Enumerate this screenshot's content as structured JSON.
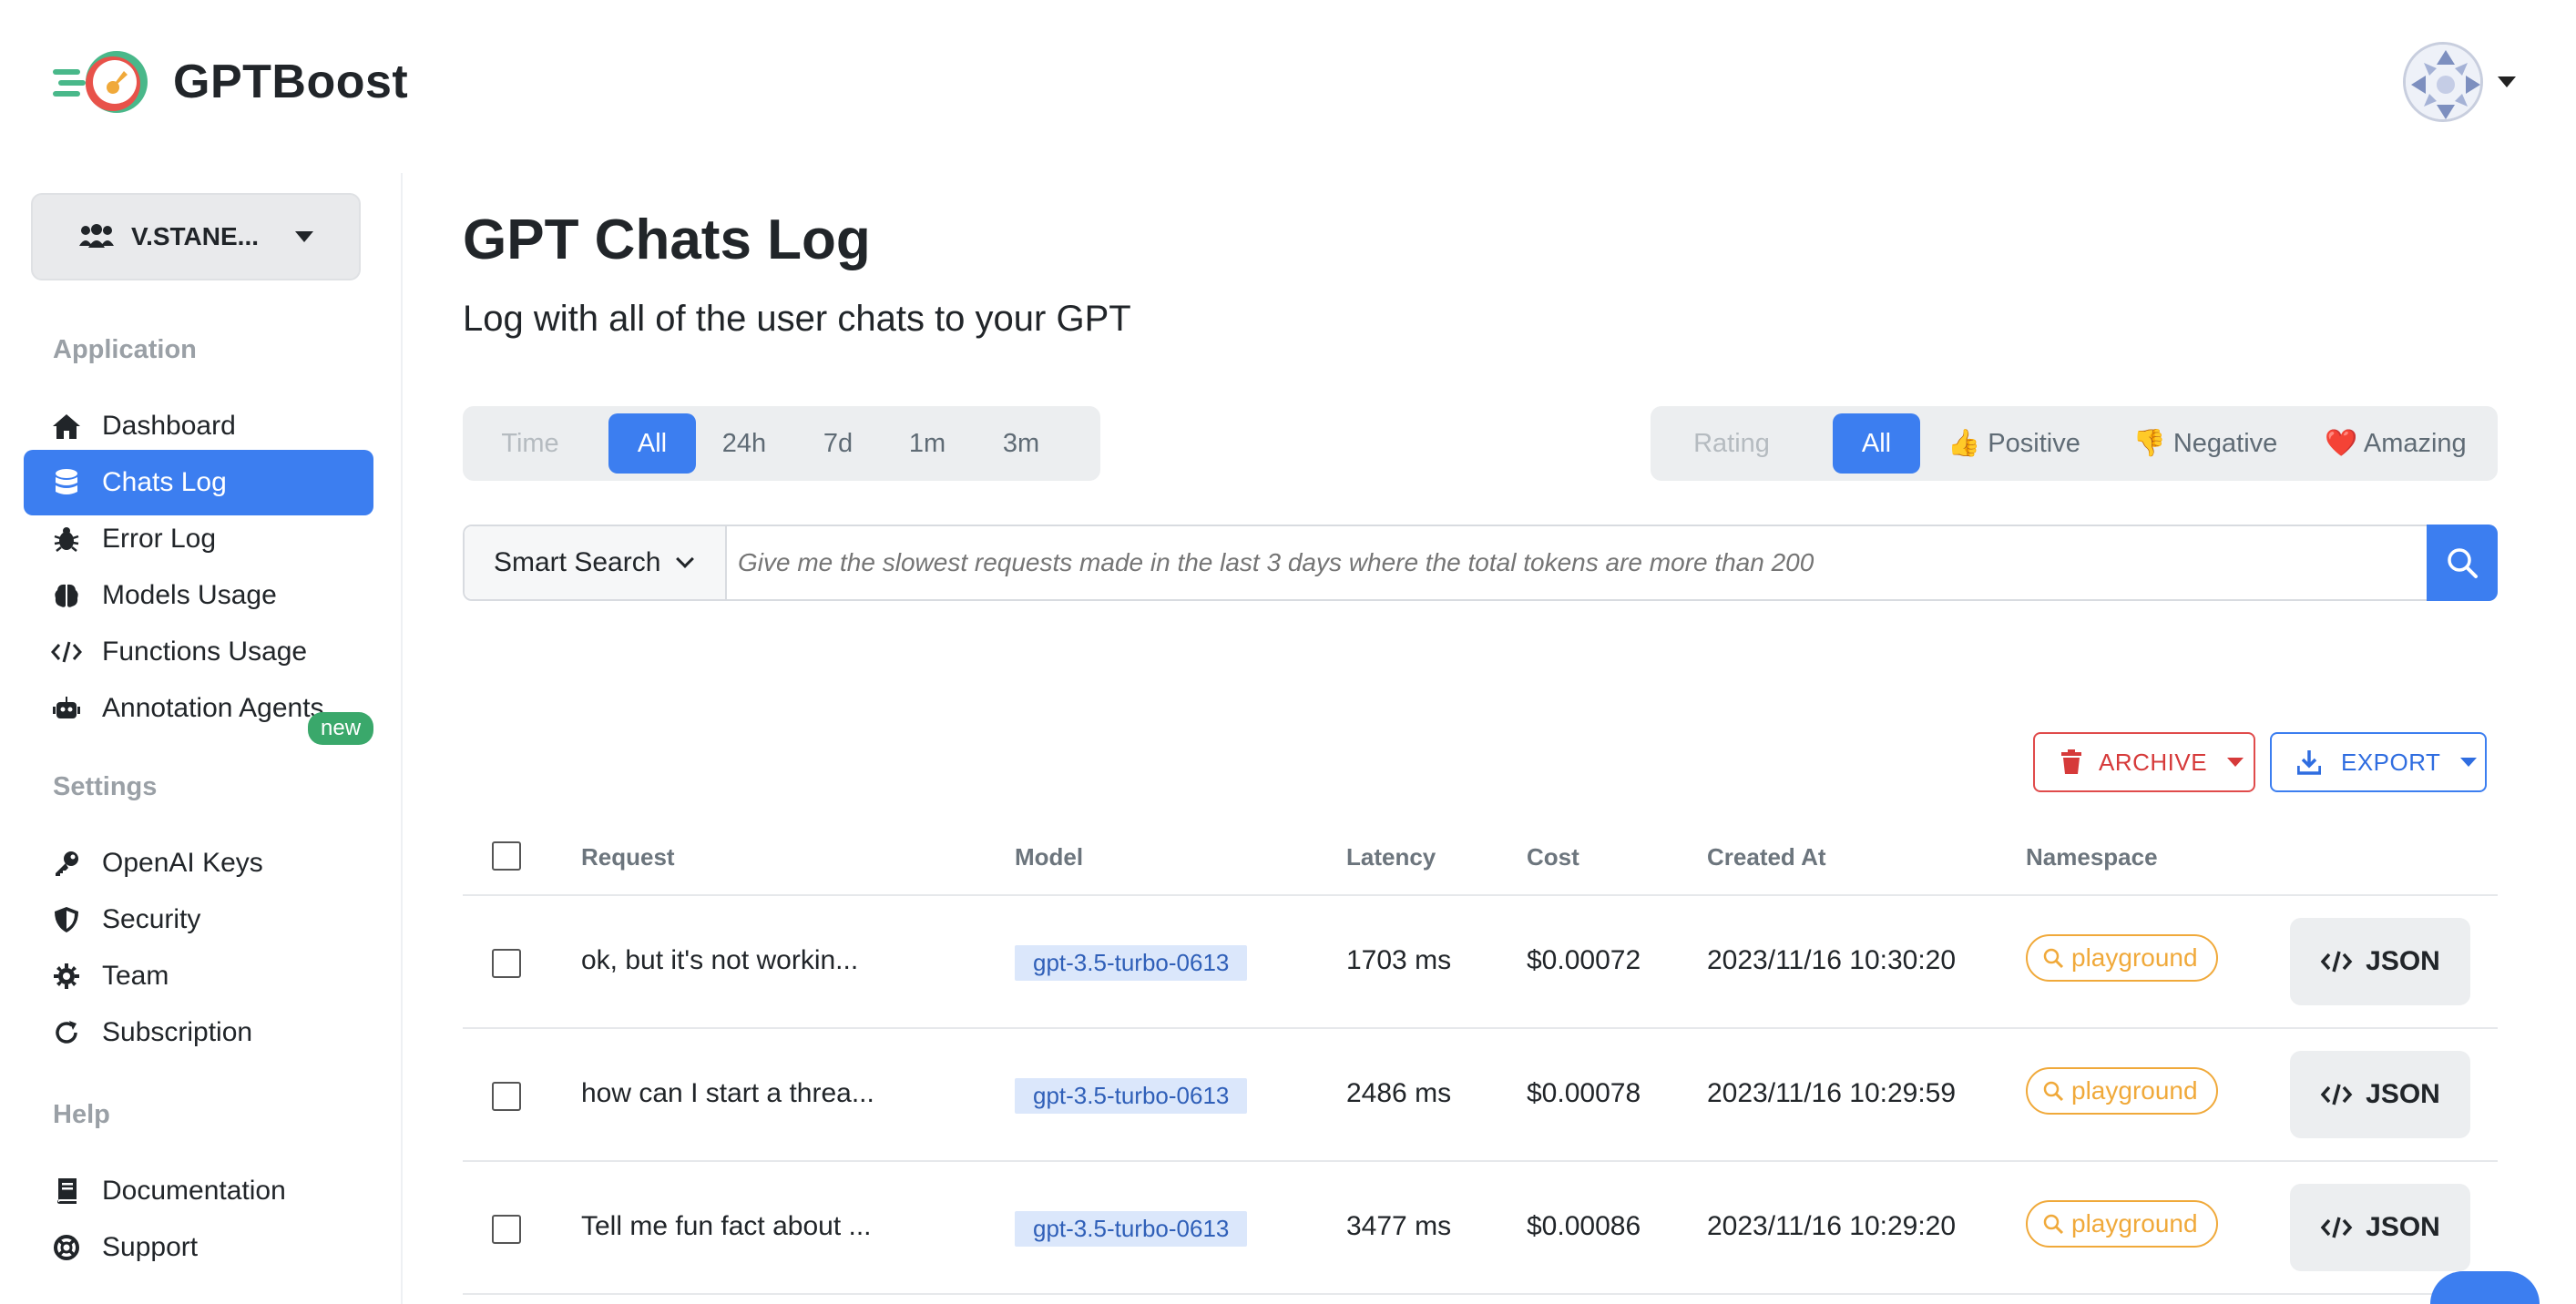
{
  "app": {
    "brand": "GPTBoost",
    "colors": {
      "accent": "#3c7ef0",
      "archive": "#d63a3a",
      "namespace": "#f0a93a",
      "new_badge": "#3aa86b"
    }
  },
  "sidebar": {
    "org_label": "V.STANE...",
    "sections": [
      {
        "label": "Application"
      },
      {
        "label": "Settings"
      },
      {
        "label": "Help"
      }
    ],
    "items": [
      {
        "label": "Dashboard",
        "icon": "home-icon"
      },
      {
        "label": "Chats Log",
        "icon": "database-icon",
        "active": true
      },
      {
        "label": "Error Log",
        "icon": "bug-icon"
      },
      {
        "label": "Models Usage",
        "icon": "brain-icon"
      },
      {
        "label": "Functions Usage",
        "icon": "code-icon"
      },
      {
        "label": "Annotation Agents",
        "icon": "robot-icon",
        "badge": "new"
      },
      {
        "label": "OpenAI Keys",
        "icon": "key-icon"
      },
      {
        "label": "Security",
        "icon": "shield-icon"
      },
      {
        "label": "Team",
        "icon": "gear-icon"
      },
      {
        "label": "Subscription",
        "icon": "refresh-icon"
      },
      {
        "label": "Documentation",
        "icon": "book-icon"
      },
      {
        "label": "Support",
        "icon": "lifebuoy-icon"
      }
    ]
  },
  "main": {
    "title": "GPT Chats Log",
    "subtitle": "Log with all of the user chats to your GPT",
    "time_filter": {
      "label": "Time",
      "options": [
        "All",
        "24h",
        "7d",
        "1m",
        "3m"
      ],
      "selected": "All"
    },
    "rating_filter": {
      "label": "Rating",
      "options": [
        "All",
        "👍 Positive",
        "👎 Negative",
        "❤️ Amazing"
      ],
      "selected": "All"
    },
    "search": {
      "mode": "Smart Search",
      "placeholder": "Give me the slowest requests made in the last 3 days where the total tokens are more than 200"
    },
    "actions": {
      "archive": "ARCHIVE",
      "export": "EXPORT"
    },
    "table": {
      "columns": [
        "Request",
        "Model",
        "Latency",
        "Cost",
        "Created At",
        "Namespace"
      ],
      "rows": [
        {
          "request": "ok, but it's not workin...",
          "model": "gpt-3.5-turbo-0613",
          "latency": "1703 ms",
          "cost": "$0.00072",
          "created_at": "2023/11/16 10:30:20",
          "namespace": "playground",
          "json": "JSON"
        },
        {
          "request": "how can I start a threa...",
          "model": "gpt-3.5-turbo-0613",
          "latency": "2486 ms",
          "cost": "$0.00078",
          "created_at": "2023/11/16 10:29:59",
          "namespace": "playground",
          "json": "JSON"
        },
        {
          "request": "Tell me fun fact about ...",
          "model": "gpt-3.5-turbo-0613",
          "latency": "3477 ms",
          "cost": "$0.00086",
          "created_at": "2023/11/16 10:29:20",
          "namespace": "playground",
          "json": "JSON"
        }
      ]
    }
  }
}
